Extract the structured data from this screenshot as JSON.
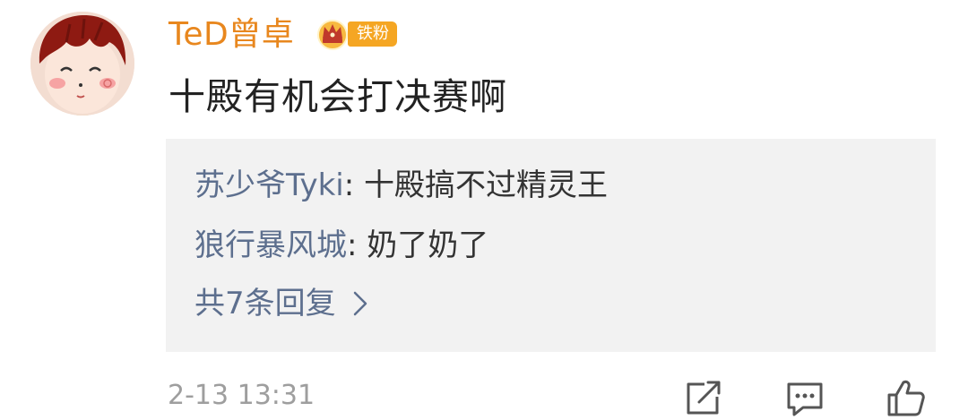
{
  "user": {
    "name": "TeD曾卓",
    "badge": {
      "icon": "crown-badge-icon",
      "label": "铁粉",
      "color": "#f5a623"
    }
  },
  "comment": {
    "text": "十殿有机会打决赛啊",
    "timestamp": "2-13 13:31"
  },
  "replies": {
    "items": [
      {
        "name": "苏少爷Tyki",
        "separator": ": ",
        "text": "十殿搞不过精灵王"
      },
      {
        "name": "狼行暴风城",
        "separator": ": ",
        "text": "奶了奶了"
      }
    ],
    "more_label": "共7条回复"
  },
  "actions": [
    {
      "icon": "share-icon"
    },
    {
      "icon": "comment-icon"
    },
    {
      "icon": "like-icon"
    }
  ],
  "colors": {
    "username": "#e8871e",
    "reply_name": "#5d6f8e",
    "reply_bg": "#f2f2f2",
    "timestamp": "#9e9e9e"
  }
}
